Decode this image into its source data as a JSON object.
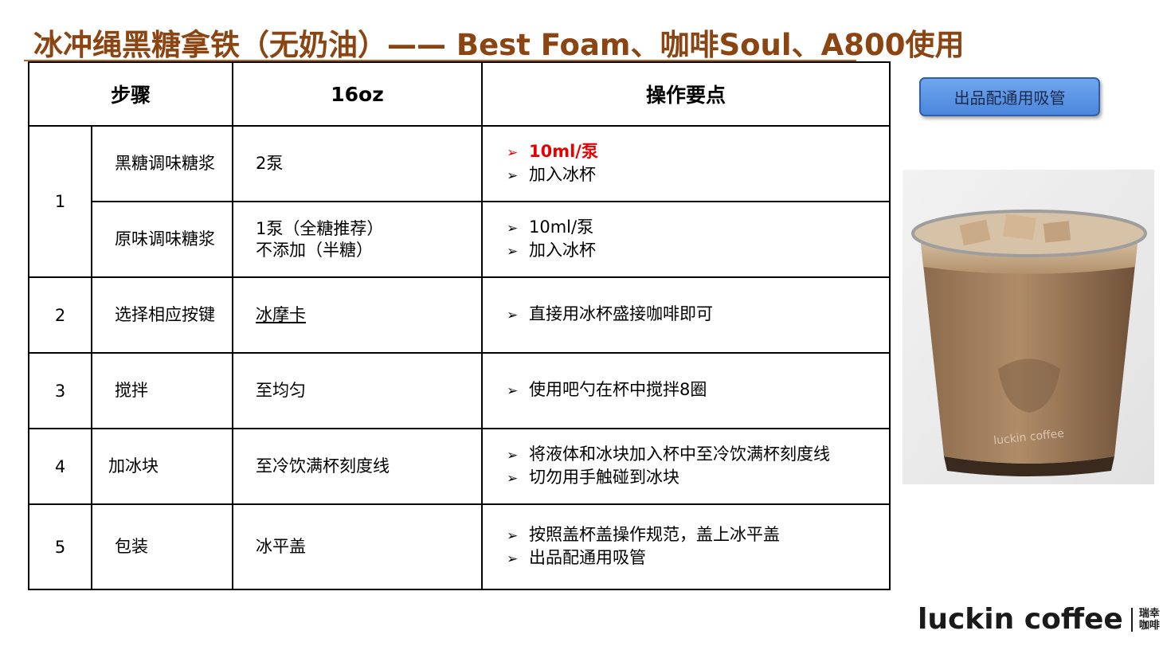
{
  "title": "冰冲绳黑糖拿铁（无奶油）—— Best Foam、咖啡Soul、A800使用",
  "table": {
    "headers": [
      "步骤",
      "16oz",
      "操作要点"
    ],
    "rows": [
      {
        "step": "1",
        "name": "黑糖调味糖浆",
        "spec": "2泵",
        "points": [
          "10ml/泵",
          "加入冰杯"
        ]
      },
      {
        "step": "1",
        "name": "原味调味糖浆",
        "spec_lines": [
          "1泵（全糖推荐）",
          "不添加（半糖）"
        ],
        "points": [
          "10ml/泵",
          "加入冰杯"
        ]
      },
      {
        "step": "2",
        "name": "选择相应按键",
        "spec": "冰摩卡",
        "points": [
          "直接用冰杯盛接咖啡即可"
        ]
      },
      {
        "step": "3",
        "name": "搅拌",
        "spec": "至均匀",
        "points": [
          "使用吧勺在杯中搅拌8圈"
        ]
      },
      {
        "step": "4",
        "name": "加冰块",
        "spec": "至冷饮满杯刻度线",
        "points": [
          "将液体和冰块加入杯中至冷饮满杯刻度线",
          "切勿用手触碰到冰块"
        ]
      },
      {
        "step": "5",
        "name": "包装",
        "spec": "冰平盖",
        "points": [
          "按照盖杯盖操作规范，盖上冰平盖",
          "出品配通用吸管"
        ]
      }
    ]
  },
  "note_button": "出品配通用吸管",
  "photo": {
    "cup_text": "luckin coffee"
  },
  "logo": {
    "brand": "luckin coffee",
    "cn_line1": "瑞幸",
    "cn_line2": "咖啡"
  },
  "colors": {
    "title": "#8b4513",
    "highlight": "#e60000",
    "button": "#5b95e6"
  },
  "icons": {
    "bullet": "arrow-bullet-icon"
  }
}
